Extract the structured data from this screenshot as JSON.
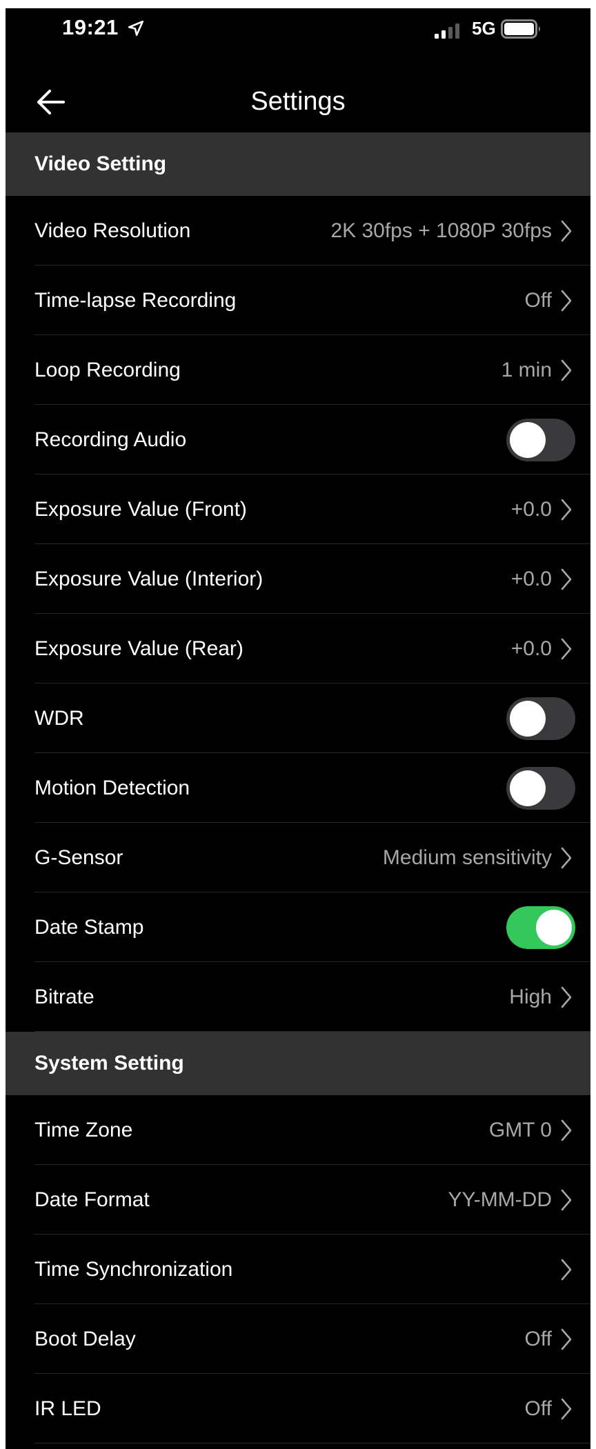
{
  "status_bar": {
    "time": "19:21",
    "network": "5G",
    "icons": [
      "location-arrow-icon",
      "signal-bars-icon",
      "battery-icon"
    ]
  },
  "nav": {
    "title": "Settings",
    "back_icon": "arrow-left-icon"
  },
  "colors": {
    "background": "#000000",
    "section_header": "#323232",
    "toggle_on": "#34c759",
    "toggle_off": "#3a3a3c",
    "value_text": "#a8a8a8"
  },
  "sections": [
    {
      "header": "Video Setting",
      "rows": [
        {
          "label": "Video Resolution",
          "value": "2K 30fps + 1080P 30fps",
          "type": "nav"
        },
        {
          "label": "Time-lapse Recording",
          "value": "Off",
          "type": "nav"
        },
        {
          "label": "Loop Recording",
          "value": "1 min",
          "type": "nav"
        },
        {
          "label": "Recording Audio",
          "type": "toggle",
          "on": false
        },
        {
          "label": "Exposure Value (Front)",
          "value": "+0.0",
          "type": "nav"
        },
        {
          "label": "Exposure Value (Interior)",
          "value": "+0.0",
          "type": "nav"
        },
        {
          "label": "Exposure Value (Rear)",
          "value": "+0.0",
          "type": "nav"
        },
        {
          "label": "WDR",
          "type": "toggle",
          "on": false
        },
        {
          "label": "Motion Detection",
          "type": "toggle",
          "on": false
        },
        {
          "label": "G-Sensor",
          "value": "Medium sensitivity",
          "type": "nav"
        },
        {
          "label": "Date Stamp",
          "type": "toggle",
          "on": true
        },
        {
          "label": "Bitrate",
          "value": "High",
          "type": "nav"
        }
      ]
    },
    {
      "header": "System Setting",
      "rows": [
        {
          "label": "Time Zone",
          "value": "GMT 0",
          "type": "nav"
        },
        {
          "label": "Date Format",
          "value": "YY-MM-DD",
          "type": "nav"
        },
        {
          "label": "Time Synchronization",
          "value": "",
          "type": "nav"
        },
        {
          "label": "Boot Delay",
          "value": "Off",
          "type": "nav"
        },
        {
          "label": "IR LED",
          "value": "Off",
          "type": "nav"
        }
      ]
    }
  ]
}
